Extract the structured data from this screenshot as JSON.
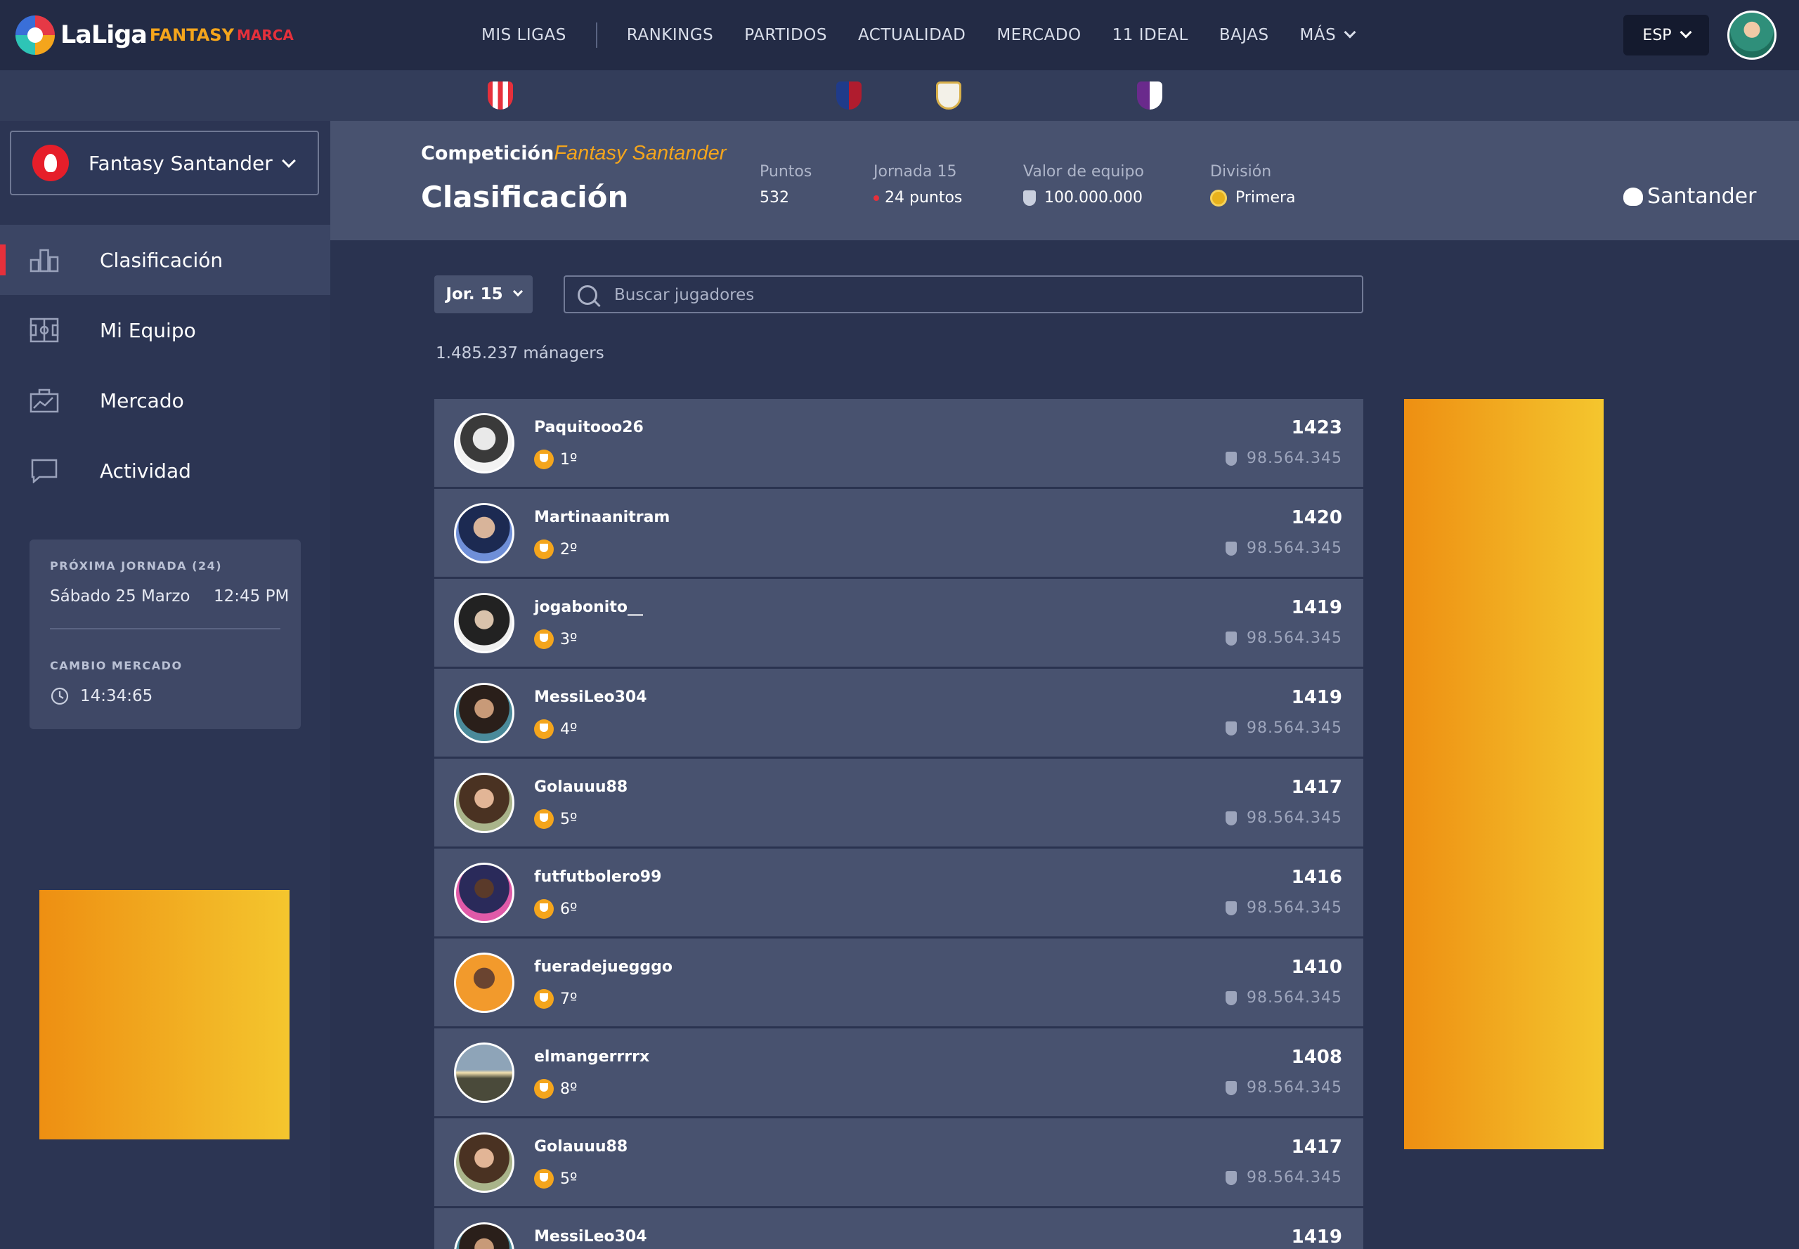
{
  "brand": {
    "name": "LaLiga",
    "fantasy": "FANTASY",
    "marca": "MARCA"
  },
  "nav": {
    "items": [
      "MIS LIGAS",
      "RANKINGS",
      "PARTIDOS",
      "ACTUALIDAD",
      "MERCADO",
      "11 IDEAL",
      "BAJAS",
      "MÁS"
    ],
    "language": "ESP"
  },
  "sidebar": {
    "league": "Fantasy Santander",
    "menu": [
      "Clasificación",
      "Mi Equipo",
      "Mercado",
      "Actividad"
    ],
    "next_round": {
      "heading": "PRÓXIMA JORNADA (24)",
      "date": "Sábado 25 Marzo",
      "time": "12:45 PM"
    },
    "market": {
      "heading": "CAMBIO MERCADO",
      "countdown": "14:34:65"
    }
  },
  "header": {
    "competition_label": "Competición",
    "competition_name": "Fantasy Santander",
    "title": "Clasificación",
    "stats": [
      {
        "label": "Puntos",
        "value": "532"
      },
      {
        "label": "Jornada 15",
        "value": "24 puntos"
      },
      {
        "label": "Valor de equipo",
        "value": "100.000.000"
      },
      {
        "label": "División",
        "value": "Primera"
      }
    ],
    "sponsor": "Santander"
  },
  "controls": {
    "round": "Jor. 15",
    "search_placeholder": "Buscar jugadores",
    "managers_count": "1.485.237 mánagers"
  },
  "colors": {
    "accent": "#f4a51c",
    "brand_red": "#e6303b",
    "row_bg": "#48526f"
  },
  "ranking": [
    {
      "name": "Paquitooo26",
      "rank": "1º",
      "points": "1423",
      "value": "98.564.345"
    },
    {
      "name": "Martinaanitram",
      "rank": "2º",
      "points": "1420",
      "value": "98.564.345"
    },
    {
      "name": "jogabonito__",
      "rank": "3º",
      "points": "1419",
      "value": "98.564.345"
    },
    {
      "name": "MessiLeo304",
      "rank": "4º",
      "points": "1419",
      "value": "98.564.345"
    },
    {
      "name": "Golauuu88",
      "rank": "5º",
      "points": "1417",
      "value": "98.564.345"
    },
    {
      "name": "futfutbolero99",
      "rank": "6º",
      "points": "1416",
      "value": "98.564.345"
    },
    {
      "name": "fueradejuegggo",
      "rank": "7º",
      "points": "1410",
      "value": "98.564.345"
    },
    {
      "name": "elmangerrrrx",
      "rank": "8º",
      "points": "1408",
      "value": "98.564.345"
    },
    {
      "name": "Golauuu88",
      "rank": "5º",
      "points": "1417",
      "value": "98.564.345"
    },
    {
      "name": "MessiLeo304",
      "rank": "",
      "points": "1419",
      "value": ""
    }
  ]
}
